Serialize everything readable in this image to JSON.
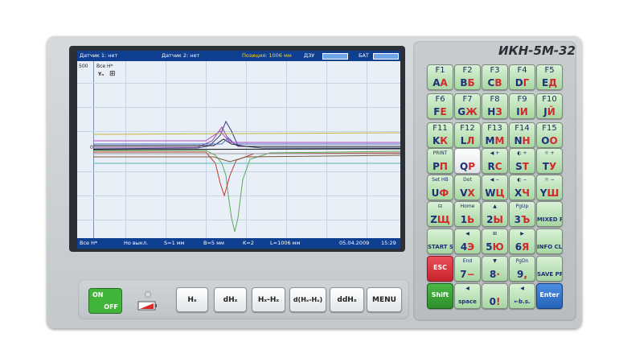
{
  "device": {
    "model": "ИКН-5М-32",
    "colors": {
      "body": "#c9ced1",
      "screen_bar": "#0f3f91",
      "key_green": "#bfe5bb",
      "esc": "#d63a42",
      "shift": "#39a936",
      "enter": "#3578cf"
    }
  },
  "screen": {
    "topbar": {
      "sensor1": "Датчик 1: нет",
      "sensor2": "Датчик 2: нет",
      "position": "Позиция: 1006 мм",
      "dzu": "ДЗУ",
      "bat": "БАТ"
    },
    "plot": {
      "scale_top": "500",
      "series_label": "Все Н*",
      "axis_symbol": "Yₙ",
      "grid_icon": "grid-icon",
      "zero_label": "0"
    },
    "botbar": {
      "mode": "Все Н*",
      "filter": "Но выкл.",
      "s": "S=1 мм",
      "b": "B=5 мм",
      "k": "K=2",
      "l": "L=1006 мм",
      "date": "05.04.2009",
      "time": "15:29"
    }
  },
  "controls": {
    "on": "ON",
    "off": "OFF",
    "battery_icon": "battery-low-icon",
    "buttons": [
      "Hₓ",
      "dHₓ",
      "Hₓ-Hₓ",
      "d(Hₓ-Hₓ)",
      "ddHₓ",
      "MENU"
    ]
  },
  "keypad": {
    "rows": [
      [
        {
          "top": "F1",
          "lat": "A",
          "cyr": "А"
        },
        {
          "top": "F2",
          "lat": "B",
          "cyr": "Б"
        },
        {
          "top": "F3",
          "lat": "C",
          "cyr": "В"
        },
        {
          "top": "F4",
          "lat": "D",
          "cyr": "Г"
        },
        {
          "top": "F5",
          "lat": "E",
          "cyr": "Д"
        }
      ],
      [
        {
          "top": "F6",
          "lat": "F",
          "cyr": "Е"
        },
        {
          "top": "F7",
          "lat": "G",
          "cyr": "Ж"
        },
        {
          "top": "F8",
          "lat": "H",
          "cyr": "З"
        },
        {
          "top": "F9",
          "lat": "I",
          "cyr": "И"
        },
        {
          "top": "F10",
          "lat": "J",
          "cyr": "Й"
        }
      ],
      [
        {
          "top": "F11",
          "lat": "K",
          "cyr": "К"
        },
        {
          "top": "F12",
          "lat": "L",
          "cyr": "Л"
        },
        {
          "top": "F13",
          "lat": "M",
          "cyr": "М"
        },
        {
          "top": "F14",
          "lat": "N",
          "cyr": "Н"
        },
        {
          "top": "F15",
          "lat": "O",
          "cyr": "О"
        }
      ],
      [
        {
          "top": "PRINT",
          "lat": "P",
          "cyr": "П"
        },
        {
          "top": "",
          "lat": "Q",
          "cyr": "Р"
        },
        {
          "top": "◀ +",
          "lat": "R",
          "cyr": "С"
        },
        {
          "top": "◐ +",
          "lat": "S",
          "cyr": "Т"
        },
        {
          "top": "☼ +",
          "lat": "T",
          "cyr": "У"
        }
      ],
      [
        {
          "top": "Set HB",
          "lat": "U",
          "cyr": "Ф"
        },
        {
          "top": "Dot",
          "lat": "V",
          "cyr": "Х"
        },
        {
          "top": "◀ −",
          "lat": "W",
          "cyr": "Ц"
        },
        {
          "top": "◐ −",
          "lat": "X",
          "cyr": "Ч"
        },
        {
          "top": "☼ −",
          "lat": "Y",
          "cyr": "Ш"
        }
      ],
      [
        {
          "top": "⊟",
          "lat": "Z",
          "cyr": "Щ"
        },
        {
          "top": "Home",
          "lat": "1",
          "cyr": "Ь"
        },
        {
          "top": "▲",
          "lat": "2",
          "cyr": "Ы"
        },
        {
          "top": "PgUp",
          "lat": "3",
          "cyr": "Ъ"
        },
        {
          "top": "",
          "lat": "MIXED RUS LAT",
          "cyr": ""
        }
      ],
      [
        {
          "top": "",
          "lat": "START STOP",
          "cyr": ""
        },
        {
          "top": "◀",
          "lat": "4",
          "cyr": "Э"
        },
        {
          "top": "⊞",
          "lat": "5",
          "cyr": "Ю"
        },
        {
          "top": "▶",
          "lat": "6",
          "cyr": "Я"
        },
        {
          "top": "",
          "lat": "INFO CLEAR",
          "cyr": ""
        }
      ],
      [
        {
          "top": "",
          "lat": "ESC",
          "cyr": ""
        },
        {
          "top": "End",
          "lat": "7",
          "cyr": "−"
        },
        {
          "top": "▼",
          "lat": "8",
          "cyr": "·"
        },
        {
          "top": "PgDn",
          "lat": "9",
          "cyr": ","
        },
        {
          "top": "",
          "lat": "SAVE PREV.",
          "cyr": ""
        }
      ],
      [
        {
          "top": "",
          "lat": "Shift",
          "cyr": ""
        },
        {
          "top": "◀",
          "lat": "space",
          "cyr": ""
        },
        {
          "top": "",
          "lat": "0",
          "cyr": "!"
        },
        {
          "top": "◀",
          "lat": "←b.s.",
          "cyr": ""
        },
        {
          "top": "",
          "lat": "Enter",
          "cyr": ""
        }
      ]
    ]
  }
}
